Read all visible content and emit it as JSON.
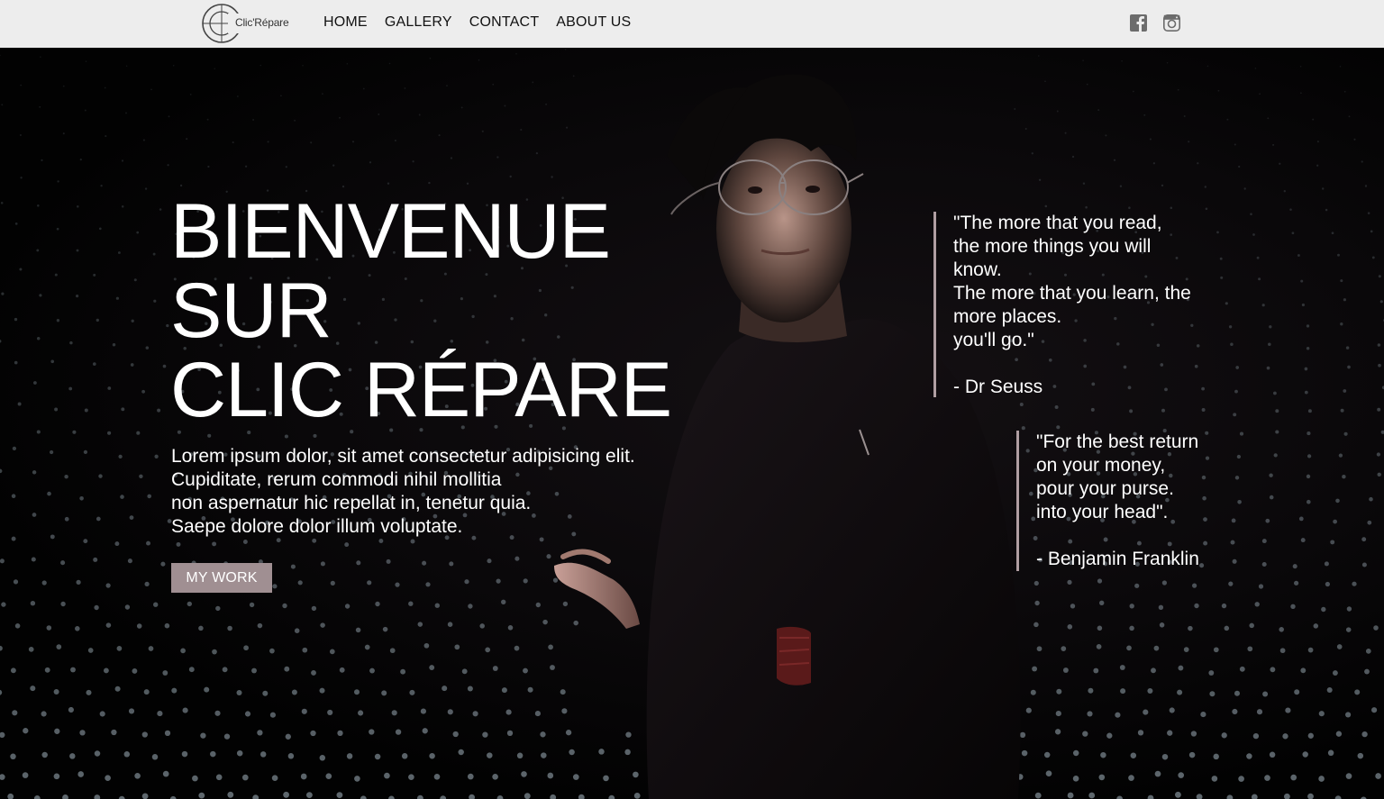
{
  "header": {
    "logo_text": "Clic'Répare",
    "nav": [
      "HOME",
      "GALLERY",
      "CONTACT",
      "ABOUT US"
    ],
    "social": [
      "facebook-icon",
      "instagram-icon"
    ]
  },
  "hero": {
    "title_lines": [
      "BIENVENUE",
      "SUR",
      "CLIC RÉPARE"
    ],
    "lead_lines": [
      "Lorem ipsum dolor, sit amet consectetur adipisicing elit.",
      "Cupiditate, rerum commodi nihil mollitia",
      "non aspernatur hic repellat in, tenetur quia.",
      "Saepe dolore dolor illum voluptate."
    ],
    "button_label": "MY WORK"
  },
  "quotes": [
    {
      "lines": [
        "\"The more that you read,",
        "the more things you will",
        "know.",
        "The more that you learn, the",
        "more places.",
        "you'll go.\""
      ],
      "author": "- Dr Seuss"
    },
    {
      "lines": [
        "\"For the best return",
        "on your money,",
        "pour your purse.",
        "into your head\"."
      ],
      "author": "- Benjamin Franklin"
    }
  ],
  "colors": {
    "header_bg": "#ededed",
    "button_bg": "#a08f92",
    "quote_bar": "#b09ea2",
    "hero_bg": "#000000"
  }
}
